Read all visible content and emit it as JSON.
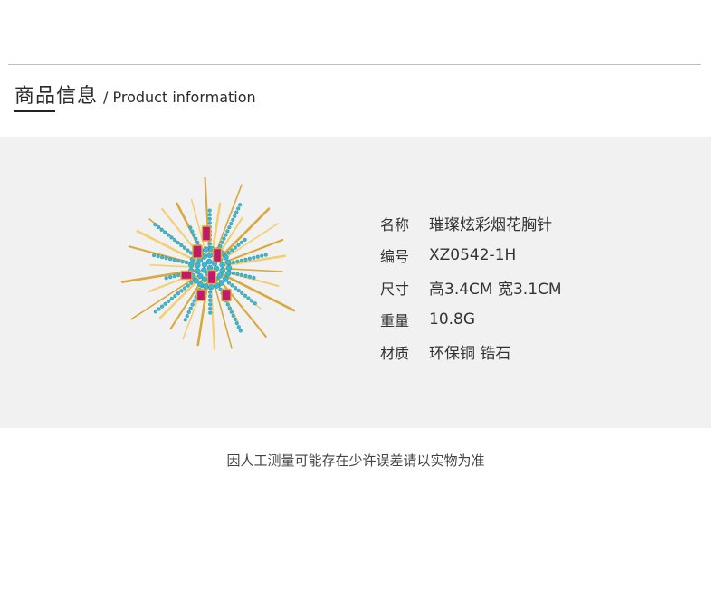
{
  "header": {
    "title_cn": "商品信息",
    "title_en": "/ Product information"
  },
  "specs": [
    {
      "label": "名称",
      "value": "璀璨炫彩烟花胸针"
    },
    {
      "label": "编号",
      "value": "XZ0542-1H"
    },
    {
      "label": "尺寸",
      "value": "高3.4CM 宽3.1CM"
    },
    {
      "label": "重量",
      "value": "10.8G"
    },
    {
      "label": "材质",
      "value": "环保铜 锆石"
    }
  ],
  "disclaimer": "因人工测量可能存在少许误差请以实物为准",
  "colors": {
    "panel_bg": "#f1f1f1",
    "gold": "#d9a93b",
    "turquoise": "#3fb6cf",
    "magenta": "#c01a6a"
  }
}
